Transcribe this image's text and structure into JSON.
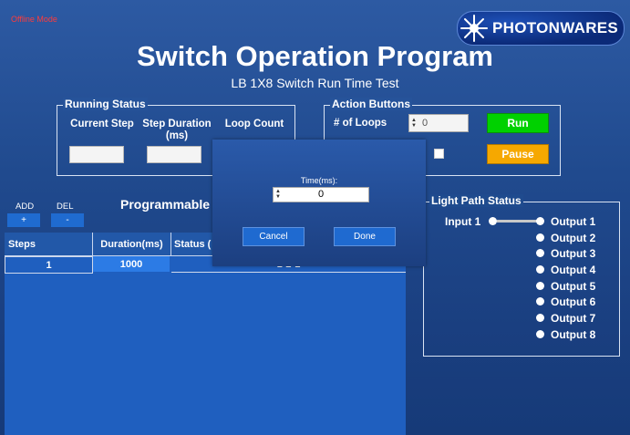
{
  "offline_mode": "Offline Mode",
  "logo_text": "PHOTONWARES",
  "title": "Switch Operation Program",
  "subtitle": "LB 1X8 Switch Run Time Test",
  "running_status": {
    "legend": "Running Status",
    "current_step": "Current Step",
    "step_duration": "Step Duration (ms)",
    "loop_count": "Loop Count"
  },
  "action_buttons": {
    "legend": "Action Buttons",
    "loops_label": "# of Loops",
    "loops_value": "0",
    "run": "Run",
    "pause": "Pause"
  },
  "programmable": {
    "add_label": "ADD",
    "add_button": "+",
    "del_label": "DEL",
    "del_button": "-",
    "title": "Programmable",
    "columns": [
      "Steps",
      "Duration(ms)",
      "Status ( Paths)"
    ],
    "rows": [
      {
        "step": "1",
        "duration": "1000",
        "status": "1-2-1"
      }
    ]
  },
  "dialog": {
    "time_label": "Time(ms):",
    "time_value": "0",
    "cancel": "Cancel",
    "done": "Done"
  },
  "light_path": {
    "legend": "Light Path Status",
    "input": "Input 1",
    "outputs": [
      "Output 1",
      "Output 2",
      "Output 3",
      "Output 4",
      "Output 5",
      "Output 6",
      "Output 7",
      "Output 8"
    ]
  },
  "colors": {
    "run": "#00d100",
    "pause": "#f6a800",
    "offline": "#ff3b3b"
  }
}
